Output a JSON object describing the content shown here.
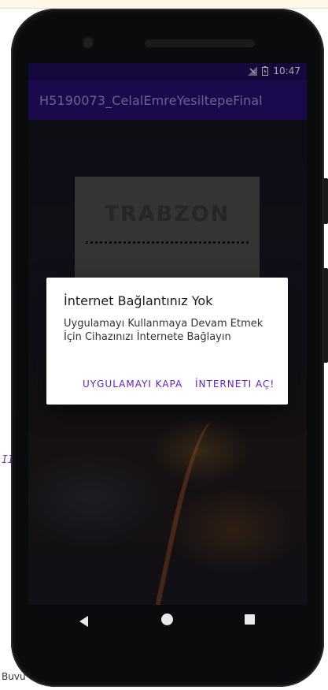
{
  "statusbar": {
    "time": "10:47"
  },
  "app": {
    "title": "H5190073_CelalEmreYesiltepeFinal"
  },
  "logo": {
    "text": "TRABZON"
  },
  "dialog": {
    "title": "İnternet Bağlantınız Yok",
    "message": "Uygulamayı Kullanmaya Devam Etmek İçin Cihazınızı İnternete Bağlayın",
    "button_close": "UYGULAMAYI KAPA",
    "button_open": "İNTERNETI AÇ!"
  },
  "ide": {
    "left_text": "II",
    "bottom_text": "Buvu"
  },
  "colors": {
    "statusbar": "#1f0d5c",
    "appbar": "#2a0f78",
    "accent": "#5b1fd1"
  },
  "icons": [
    "signal-icon",
    "battery-icon",
    "nav-back-icon",
    "nav-home-icon",
    "nav-recent-icon"
  ]
}
